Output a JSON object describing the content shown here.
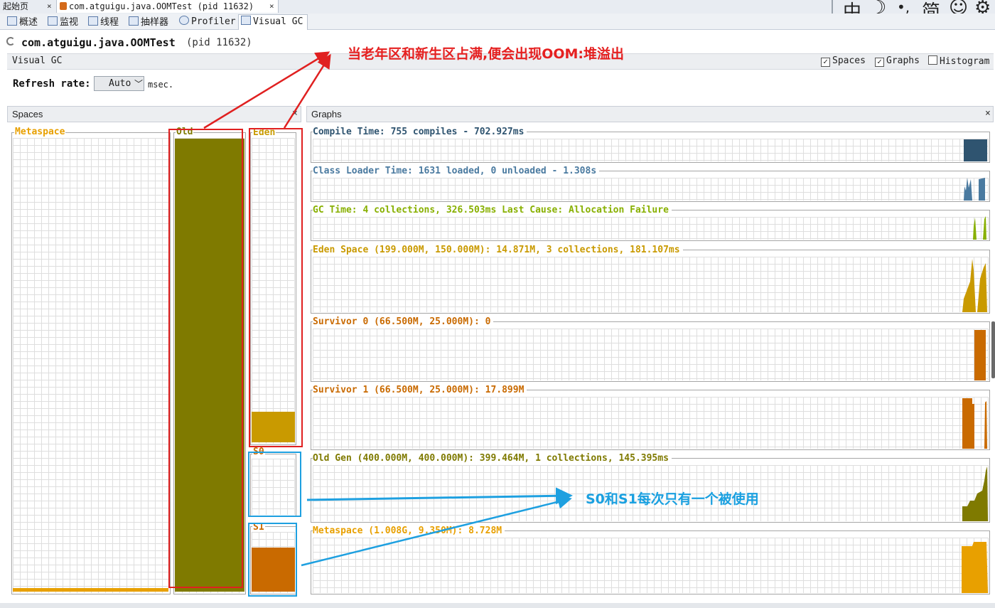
{
  "doc_tabs": [
    {
      "label": "起始页",
      "close": "×"
    },
    {
      "label": "com.atguigu.java.OOMTest (pid 11632)",
      "close": "×"
    }
  ],
  "toolbar_icons": [
    {
      "name": "chinese-input-icon",
      "glyph": "中"
    },
    {
      "name": "moon-icon",
      "glyph": "☽"
    },
    {
      "name": "punctuation-icon",
      "glyph": "•,"
    },
    {
      "name": "simplified-icon",
      "glyph": "简"
    },
    {
      "name": "smiley-icon",
      "glyph": "☺"
    },
    {
      "name": "gear-icon",
      "glyph": "⚙"
    }
  ],
  "view_tabs": [
    {
      "label": "概述"
    },
    {
      "label": "监视"
    },
    {
      "label": "线程"
    },
    {
      "label": "抽样器"
    },
    {
      "label": "Profiler"
    },
    {
      "label": "Visual GC"
    }
  ],
  "app": {
    "title": "com.atguigu.java.OOMTest",
    "pid": "(pid 11632)"
  },
  "visual_gc": {
    "label": "Visual GC",
    "options": [
      {
        "label": "Spaces",
        "checked": true,
        "mark": "✓"
      },
      {
        "label": "Graphs",
        "checked": true,
        "mark": "✓"
      },
      {
        "label": "Histogram",
        "checked": false,
        "mark": ""
      }
    ],
    "refresh_label": "Refresh rate:",
    "refresh_value": "Auto",
    "refresh_unit": "msec."
  },
  "spaces": {
    "title": "Spaces",
    "close": "×",
    "metaspace": {
      "label": "Metaspace",
      "color": "#e8a000",
      "fill_fraction": 0.008
    },
    "old": {
      "label": "Old",
      "color": "#7f7a00",
      "fill_fraction": 0.999
    },
    "eden": {
      "label": "Eden",
      "color": "#c99a00",
      "fill_fraction": 0.1
    },
    "s0": {
      "label": "S0",
      "color": "#c96a00",
      "fill_fraction": 0.0
    },
    "s1": {
      "label": "S1",
      "color": "#c96a00",
      "fill_fraction": 0.72
    }
  },
  "graphs": {
    "title": "Graphs",
    "close": "×",
    "items": [
      {
        "label": "Compile Time: 755 compiles - 702.927ms",
        "color": "#2f5470"
      },
      {
        "label": "Class Loader Time: 1631 loaded, 0 unloaded - 1.308s",
        "color": "#4a7aa0"
      },
      {
        "label": "GC Time: 4 collections, 326.503ms Last Cause: Allocation Failure",
        "color": "#88b000"
      },
      {
        "label": "Eden Space (199.000M, 150.000M): 14.871M, 3 collections, 181.107ms",
        "color": "#c99a00"
      },
      {
        "label": "Survivor 0 (66.500M, 25.000M): 0",
        "color": "#c96a00"
      },
      {
        "label": "Survivor 1 (66.500M, 25.000M): 17.899M",
        "color": "#c96a00"
      },
      {
        "label": "Old Gen (400.000M, 400.000M): 399.464M, 1 collections, 145.395ms",
        "color": "#7f7a00"
      },
      {
        "label": "Metaspace (1.008G, 9.350M): 8.728M",
        "color": "#e8a000"
      }
    ]
  },
  "annotations": {
    "top": "当老年区和新生区占满,便会出现OOM:堆溢出",
    "middle": "S0和S1每次只有一个被使用"
  }
}
